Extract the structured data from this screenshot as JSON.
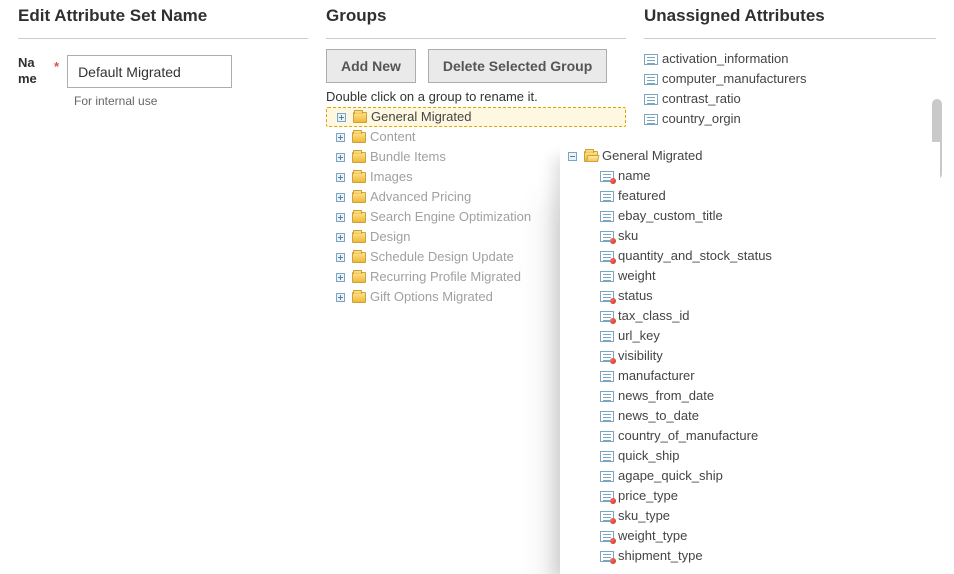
{
  "left": {
    "title": "Edit Attribute Set Name",
    "name_label": "Na\nme",
    "name_value": "Default Migrated",
    "name_hint": "For internal use"
  },
  "mid": {
    "title": "Groups",
    "add_btn": "Add New",
    "delete_btn": "Delete Selected Group",
    "hint": "Double click on a group to rename it.",
    "groups": [
      "General Migrated",
      "Content",
      "Bundle Items",
      "Images",
      "Advanced Pricing",
      "Search Engine Optimization",
      "Design",
      "Schedule Design Update",
      "Recurring Profile Migrated",
      "Gift Options Migrated"
    ]
  },
  "right": {
    "title": "Unassigned Attributes",
    "items": [
      "activation_information",
      "computer_manufacturers",
      "contrast_ratio",
      "country_orgin"
    ]
  },
  "overlay": {
    "root": "General Migrated",
    "attrs": [
      {
        "name": "name",
        "required": true
      },
      {
        "name": "featured",
        "required": false
      },
      {
        "name": "ebay_custom_title",
        "required": false
      },
      {
        "name": "sku",
        "required": true
      },
      {
        "name": "quantity_and_stock_status",
        "required": true
      },
      {
        "name": "weight",
        "required": false
      },
      {
        "name": "status",
        "required": true
      },
      {
        "name": "tax_class_id",
        "required": true
      },
      {
        "name": "url_key",
        "required": false
      },
      {
        "name": "visibility",
        "required": true
      },
      {
        "name": "manufacturer",
        "required": false
      },
      {
        "name": "news_from_date",
        "required": false
      },
      {
        "name": "news_to_date",
        "required": false
      },
      {
        "name": "country_of_manufacture",
        "required": false
      },
      {
        "name": "quick_ship",
        "required": false
      },
      {
        "name": "agape_quick_ship",
        "required": false
      },
      {
        "name": "price_type",
        "required": true
      },
      {
        "name": "sku_type",
        "required": true
      },
      {
        "name": "weight_type",
        "required": true
      },
      {
        "name": "shipment_type",
        "required": true
      }
    ]
  }
}
